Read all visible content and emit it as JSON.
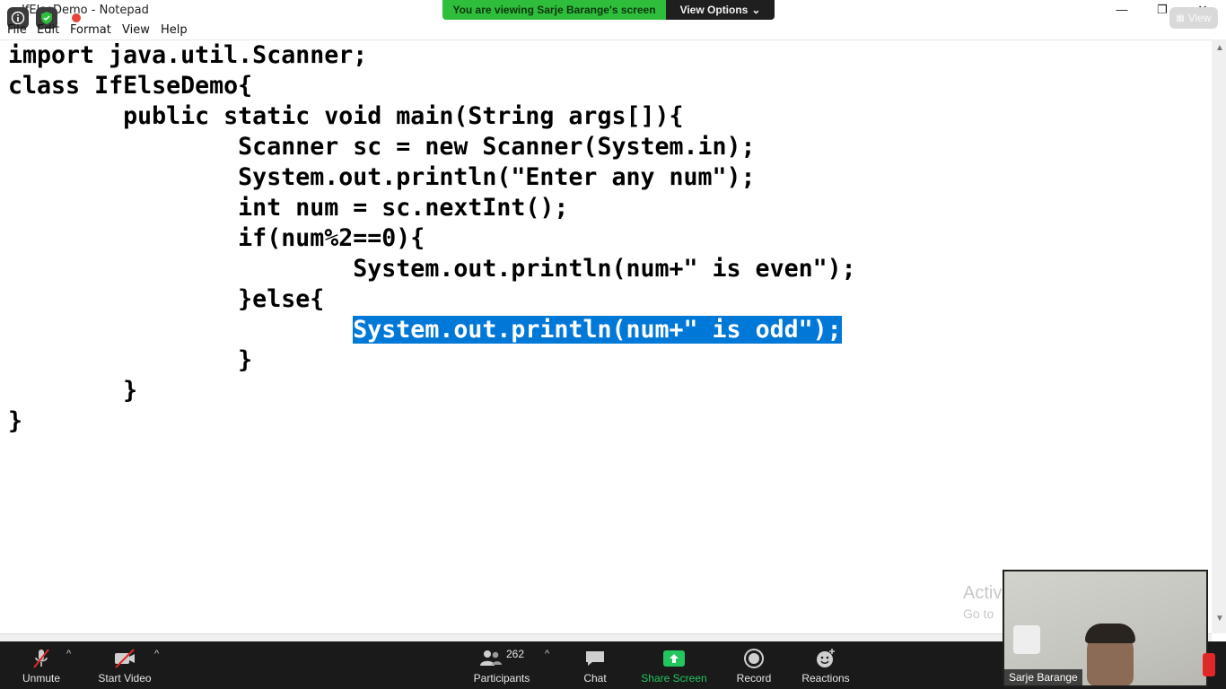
{
  "window": {
    "title": "IfElseDemo - Notepad",
    "controls": {
      "minimize": "—",
      "restore": "❐",
      "close": "✕"
    }
  },
  "menu": [
    "File",
    "Edit",
    "Format",
    "View",
    "Help"
  ],
  "share_banner": {
    "message": "You are viewing Sarje Barange's screen",
    "options_label": "View Options"
  },
  "view_button": "View",
  "code": [
    {
      "text": "import java.util.Scanner;",
      "selected": false
    },
    {
      "text": "class IfElseDemo{",
      "selected": false
    },
    {
      "text": "        public static void main(String args[]){",
      "selected": false
    },
    {
      "text": "                Scanner sc = new Scanner(System.in);",
      "selected": false
    },
    {
      "text": "                System.out.println(\"Enter any num\");",
      "selected": false
    },
    {
      "text": "                int num = sc.nextInt();",
      "selected": false
    },
    {
      "text": "                if(num%2==0){",
      "selected": false
    },
    {
      "text": "                        System.out.println(num+\" is even\");",
      "selected": false
    },
    {
      "text": "                }else{",
      "selected": false
    },
    {
      "indent": "                        ",
      "text": "System.out.println(num+\" is odd\");",
      "selected": true
    },
    {
      "text": "                }",
      "selected": false
    },
    {
      "text": "        }",
      "selected": false
    },
    {
      "text": "}",
      "selected": false
    }
  ],
  "watermark": {
    "title": "Activ",
    "subtitle": "Go to"
  },
  "toolbar": {
    "unmute": "Unmute",
    "start_video": "Start Video",
    "participants": "Participants",
    "participant_count": "262",
    "chat": "Chat",
    "share_screen": "Share Screen",
    "record": "Record",
    "reactions": "Reactions"
  },
  "video": {
    "name": "Sarje Barange"
  },
  "colors": {
    "selection": "#0078d7",
    "share_green": "#2fbd3c",
    "toolbar_bg": "#1a1a1a",
    "share_icon": "#22c55e"
  }
}
